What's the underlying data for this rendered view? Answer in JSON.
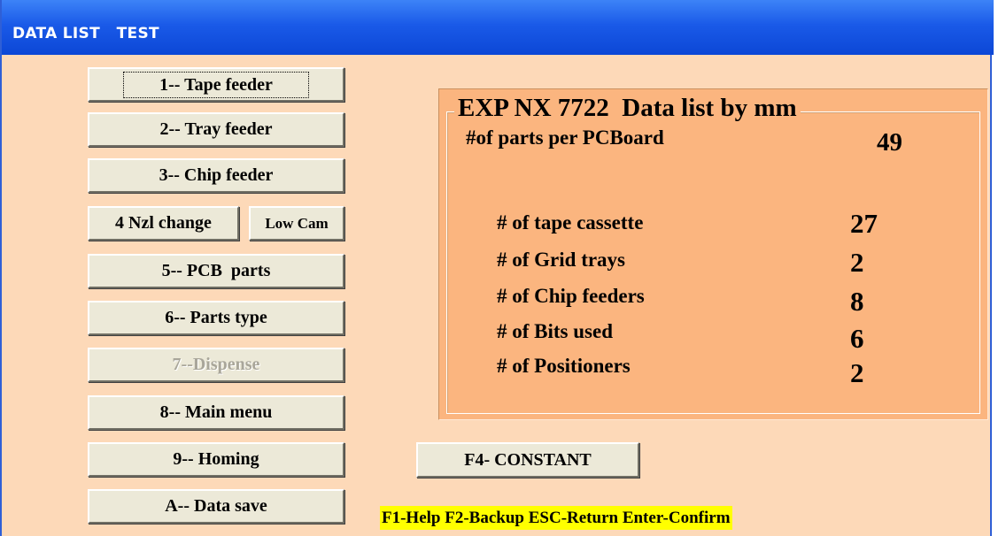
{
  "window": {
    "title": "DATA LIST   TEST"
  },
  "menu": {
    "tape_feeder": "1-- Tape feeder",
    "tray_feeder": "2-- Tray feeder",
    "chip_feeder": "3-- Chip feeder",
    "nzl_change": "4 Nzl change",
    "low_cam": "Low Cam",
    "pcb_parts": "5-- PCB  parts",
    "parts_type": "6-- Parts type",
    "dispense": "7--Dispense",
    "main_menu": "8-- Main menu",
    "homing": "9-- Homing",
    "data_save": "A-- Data save"
  },
  "panel": {
    "title": "EXP NX 7722  Data list by mm",
    "parts_per_board_label": "#of parts per PCBoard",
    "parts_per_board_value": "49",
    "rows": [
      {
        "label": "# of tape cassette",
        "value": "27"
      },
      {
        "label": "# of Grid trays",
        "value": "2"
      },
      {
        "label": "# of Chip feeders",
        "value": "8"
      },
      {
        "label": "# of Bits used",
        "value": "6"
      },
      {
        "label": "# of Positioners",
        "value": "2"
      }
    ]
  },
  "constant_button": "F4- CONSTANT",
  "hint_bar": "F1-Help F2-Backup ESC-Return Enter-Confirm",
  "colors": {
    "window_bg": "#fdd9b8",
    "panel_bg": "#fbb57f",
    "titlebar": "#1a5ae8",
    "button_face": "#ece9d8",
    "hint_highlight": "#ffff00"
  }
}
